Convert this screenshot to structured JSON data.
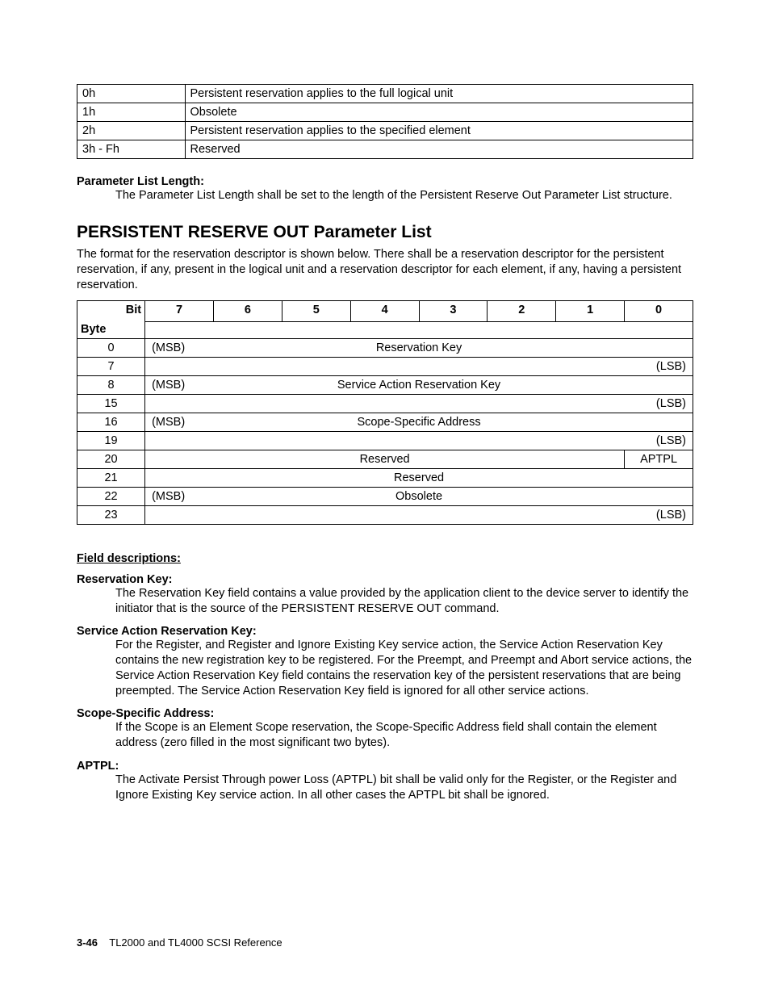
{
  "top_table": {
    "rows": [
      {
        "code": "0h",
        "desc": "Persistent reservation applies to the full logical unit"
      },
      {
        "code": "1h",
        "desc": "Obsolete"
      },
      {
        "code": "2h",
        "desc": "Persistent reservation applies to the specified element"
      },
      {
        "code": "3h - Fh",
        "desc": "Reserved"
      }
    ]
  },
  "param_list_length": {
    "label": "Parameter List Length:",
    "text": "The Parameter List Length shall be set to the length of the Persistent Reserve Out Parameter List structure."
  },
  "section": {
    "title": "PERSISTENT RESERVE OUT Parameter List",
    "intro": "The format for the reservation descriptor is shown below. There shall be a reservation descriptor for the persistent reservation, if any, present in the logical unit and a reservation descriptor for each element, if any, having a persistent reservation."
  },
  "bit_table": {
    "header": {
      "bit": "Bit",
      "byte": "Byte",
      "cols": [
        "7",
        "6",
        "5",
        "4",
        "3",
        "2",
        "1",
        "0"
      ]
    },
    "rows": [
      {
        "byte": "0",
        "msb": "(MSB)",
        "mid": "Reservation Key",
        "lsb": ""
      },
      {
        "byte": "7",
        "msb": "",
        "mid": "",
        "lsb": "(LSB)"
      },
      {
        "byte": "8",
        "msb": "(MSB)",
        "mid": "Service Action Reservation Key",
        "lsb": ""
      },
      {
        "byte": "15",
        "msb": "",
        "mid": "",
        "lsb": "(LSB)"
      },
      {
        "byte": "16",
        "msb": "(MSB)",
        "mid": "Scope-Specific Address",
        "lsb": ""
      },
      {
        "byte": "19",
        "msb": "",
        "mid": "",
        "lsb": "(LSB)"
      }
    ],
    "row20": {
      "byte": "20",
      "reserved": "Reserved",
      "aptpl": "APTPL"
    },
    "row21": {
      "byte": "21",
      "reserved": "Reserved"
    },
    "row22": {
      "byte": "22",
      "msb": "(MSB)",
      "mid": "Obsolete",
      "lsb": ""
    },
    "row23": {
      "byte": "23",
      "msb": "",
      "mid": "",
      "lsb": "(LSB)"
    }
  },
  "field_descriptions": {
    "heading": "Field descriptions:",
    "reservation_key": {
      "label": "Reservation Key:",
      "text": "The Reservation Key field contains a value provided by the application client to the device server to identify the initiator that is the source of the PERSISTENT RESERVE OUT command."
    },
    "service_action_reservation_key": {
      "label": "Service Action Reservation Key:",
      "text": "For the Register, and Register and Ignore Existing Key service action, the Service Action Reservation Key contains the new registration key to be registered. For the Preempt, and Preempt and Abort service actions, the Service Action Reservation Key field contains the reservation key of the persistent reservations that are being preempted. The Service Action Reservation Key field is ignored for all other service actions."
    },
    "scope_specific_address": {
      "label": "Scope-Specific Address:",
      "text": "If the Scope is an Element Scope reservation, the Scope-Specific Address field shall contain the element address (zero filled in the most significant two bytes)."
    },
    "aptpl": {
      "label": "APTPL:",
      "text": "The Activate Persist Through power Loss (APTPL) bit shall be valid only for the Register, or the Register and Ignore Existing Key service action. In all other cases the APTPL bit shall be ignored."
    }
  },
  "footer": {
    "page": "3-46",
    "title": "TL2000 and TL4000 SCSI Reference"
  }
}
